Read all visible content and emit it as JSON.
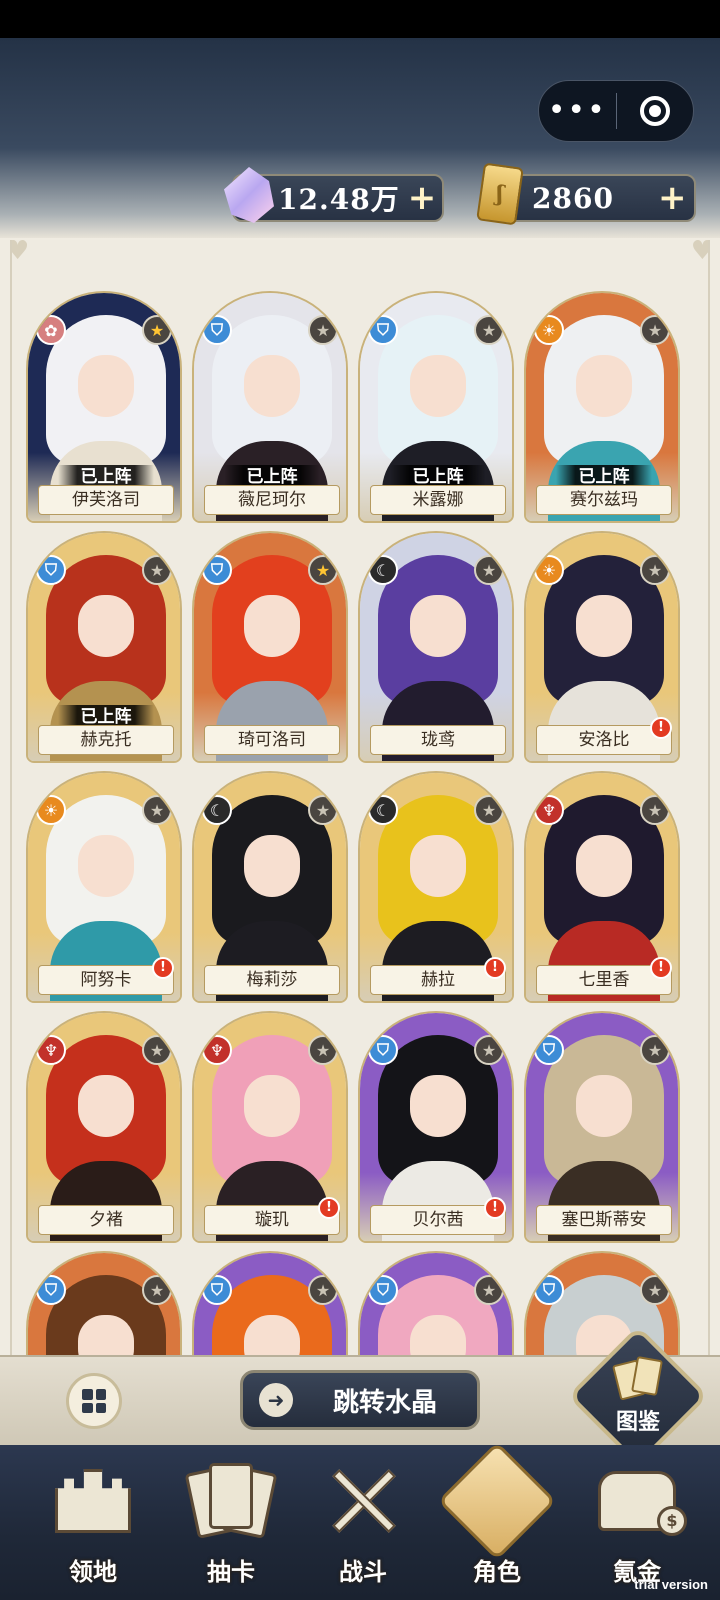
{
  "top_bar": {
    "more_glyph": "•••",
    "crystal": {
      "value": "12.48万",
      "plus": "+"
    },
    "ticket": {
      "value": "2860",
      "plus": "+"
    }
  },
  "characters": [
    {
      "name": "伊芙洛司",
      "deployed": "已上阵",
      "class_icon": "lotus-icon",
      "class_color": "#d67f7f",
      "star": "gold",
      "alert": false,
      "bg": "#1e2a55",
      "hair": "#f1f1f4",
      "outfit": "#e8e0d0"
    },
    {
      "name": "薇尼珂尔",
      "deployed": "已上阵",
      "class_icon": "helmet-icon",
      "class_color": "#3d8cd6",
      "star": "grey",
      "alert": false,
      "bg": "#e4e4ea",
      "hair": "#eceff4",
      "outfit": "#2a2026"
    },
    {
      "name": "米露娜",
      "deployed": "已上阵",
      "class_icon": "helmet-icon",
      "class_color": "#3d8cd6",
      "star": "grey",
      "alert": false,
      "bg": "#e8eaf0",
      "hair": "#e6f2f6",
      "outfit": "#1e1e26"
    },
    {
      "name": "赛尔兹玛",
      "deployed": "已上阵",
      "class_icon": "sun-eye-icon",
      "class_color": "#e88a1e",
      "star": "grey",
      "alert": false,
      "bg": "#d9773e",
      "hair": "#eef0f2",
      "outfit": "#3aa4b0"
    },
    {
      "name": "赫克托",
      "deployed": "已上阵",
      "class_icon": "helmet-icon",
      "class_color": "#3d8cd6",
      "star": "grey",
      "alert": false,
      "bg": "#e9c77a",
      "hair": "#b8321c",
      "outfit": "#b49250"
    },
    {
      "name": "琦可洛司",
      "deployed": "",
      "class_icon": "helmet-icon",
      "class_color": "#3d8cd6",
      "star": "gold",
      "alert": false,
      "bg": "#d9773e",
      "hair": "#e2401e",
      "outfit": "#9aa2ad"
    },
    {
      "name": "珑鸢",
      "deployed": "",
      "class_icon": "moon-icon",
      "class_color": "#2a2a2a",
      "star": "grey",
      "alert": false,
      "bg": "#cfd3e4",
      "hair": "#5a3ea0",
      "outfit": "#221c2e"
    },
    {
      "name": "安洛比",
      "deployed": "",
      "class_icon": "sun-eye-icon",
      "class_color": "#e88a1e",
      "star": "grey",
      "alert": true,
      "bg": "#e9c77a",
      "hair": "#23213a",
      "outfit": "#e6e2da"
    },
    {
      "name": "阿努卡",
      "deployed": "",
      "class_icon": "sun-eye-icon",
      "class_color": "#e88a1e",
      "star": "grey",
      "alert": true,
      "bg": "#e9c77a",
      "hair": "#f2f2ee",
      "outfit": "#2f9aa8"
    },
    {
      "name": "梅莉莎",
      "deployed": "",
      "class_icon": "moon-icon",
      "class_color": "#2a2a2a",
      "star": "grey",
      "alert": false,
      "bg": "#e9c77a",
      "hair": "#1a1a1e",
      "outfit": "#1d1c22"
    },
    {
      "name": "赫拉",
      "deployed": "",
      "class_icon": "moon-icon",
      "class_color": "#2a2a2a",
      "star": "grey",
      "alert": true,
      "bg": "#e9c77a",
      "hair": "#e8c21c",
      "outfit": "#1d1c22"
    },
    {
      "name": "七里香",
      "deployed": "",
      "class_icon": "dragon-icon",
      "class_color": "#c2312a",
      "star": "grey",
      "alert": true,
      "bg": "#e9c77a",
      "hair": "#1f1a2e",
      "outfit": "#b82a24"
    },
    {
      "name": "夕褚",
      "deployed": "",
      "class_icon": "dragon-icon",
      "class_color": "#c2312a",
      "star": "grey",
      "alert": false,
      "bg": "#e9c77a",
      "hair": "#c5301c",
      "outfit": "#2a1c18"
    },
    {
      "name": "璇玑",
      "deployed": "",
      "class_icon": "dragon-icon",
      "class_color": "#c2312a",
      "star": "grey",
      "alert": true,
      "bg": "#e9c77a",
      "hair": "#f0a0b8",
      "outfit": "#2a2024"
    },
    {
      "name": "贝尔茜",
      "deployed": "",
      "class_icon": "helmet-icon",
      "class_color": "#3d8cd6",
      "star": "grey",
      "alert": true,
      "bg": "#8b5cc4",
      "hair": "#141418",
      "outfit": "#eceae4"
    },
    {
      "name": "塞巴斯蒂安",
      "deployed": "",
      "class_icon": "helmet-icon",
      "class_color": "#3d8cd6",
      "star": "grey",
      "alert": false,
      "bg": "#8b5cc4",
      "hair": "#c9b896",
      "outfit": "#3a2e24"
    },
    {
      "name": "",
      "deployed": "",
      "class_icon": "helmet-icon",
      "class_color": "#3d8cd6",
      "star": "grey",
      "alert": false,
      "bg": "#d9773e",
      "hair": "#6a3a1c",
      "outfit": "#2a2020"
    },
    {
      "name": "",
      "deployed": "",
      "class_icon": "helmet-icon",
      "class_color": "#3d8cd6",
      "star": "grey",
      "alert": false,
      "bg": "#8b5cc4",
      "hair": "#ea6a1c",
      "outfit": "#2a2020"
    },
    {
      "name": "",
      "deployed": "",
      "class_icon": "helmet-icon",
      "class_color": "#3d8cd6",
      "star": "grey",
      "alert": false,
      "bg": "#8b5cc4",
      "hair": "#f0a8c0",
      "outfit": "#2a2020"
    },
    {
      "name": "",
      "deployed": "",
      "class_icon": "helmet-icon",
      "class_color": "#3d8cd6",
      "star": "grey",
      "alert": false,
      "bg": "#d9773e",
      "hair": "#c8cfd0",
      "outfit": "#2a2020"
    }
  ],
  "actions": {
    "jump_crystal": "跳转水晶",
    "atlas": "图鉴"
  },
  "nav": [
    {
      "label": "领地",
      "icon": "castle-icon"
    },
    {
      "label": "抽卡",
      "icon": "cards-icon"
    },
    {
      "label": "战斗",
      "icon": "crossed-swords-icon"
    },
    {
      "label": "角色",
      "icon": "character-icon",
      "active": true
    },
    {
      "label": "氪金",
      "icon": "treasure-chest-icon"
    }
  ],
  "watermark": "trial version"
}
